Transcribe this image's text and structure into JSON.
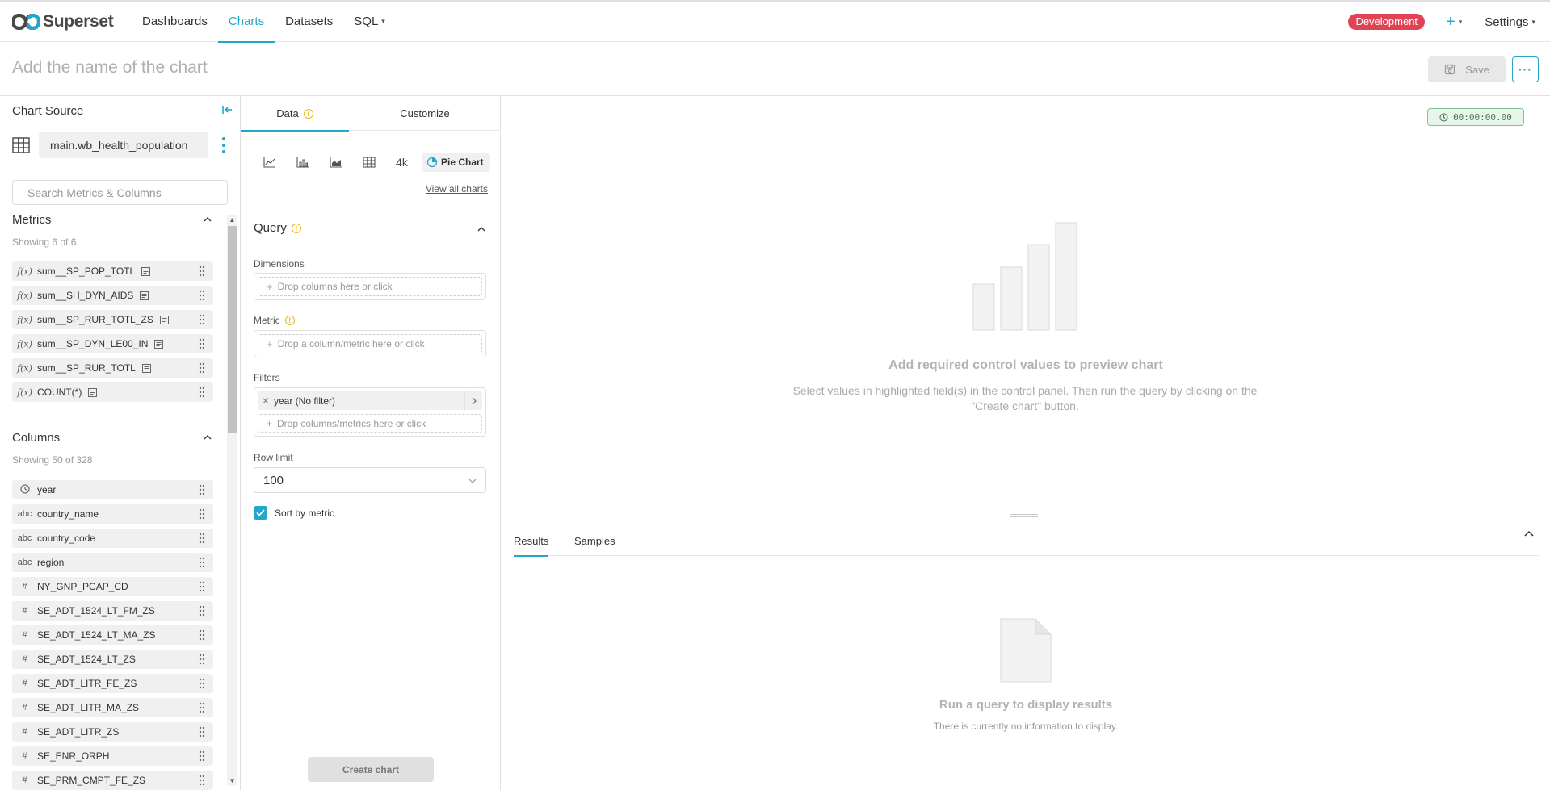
{
  "brand": {
    "name": "Superset"
  },
  "nav": {
    "items": [
      {
        "label": "Dashboards",
        "active": false
      },
      {
        "label": "Charts",
        "active": true
      },
      {
        "label": "Datasets",
        "active": false
      },
      {
        "label": "SQL",
        "active": false
      }
    ],
    "env_badge": "Development",
    "plus_label": "+",
    "settings_label": "Settings"
  },
  "header": {
    "chart_name_placeholder": "Add the name of the chart",
    "save_label": "Save",
    "more_label": "···"
  },
  "datasource": {
    "title": "Chart Source",
    "name": "main.wb_health_population",
    "search_placeholder": "Search Metrics & Columns",
    "metrics_title": "Metrics",
    "metrics_count": "Showing 6 of 6",
    "metrics": [
      {
        "type": "f(x)",
        "label": "sum__SP_POP_TOTL"
      },
      {
        "type": "f(x)",
        "label": "sum__SH_DYN_AIDS"
      },
      {
        "type": "f(x)",
        "label": "sum__SP_RUR_TOTL_ZS"
      },
      {
        "type": "f(x)",
        "label": "sum__SP_DYN_LE00_IN"
      },
      {
        "type": "f(x)",
        "label": "sum__SP_RUR_TOTL"
      },
      {
        "type": "f(x)",
        "label": "COUNT(*)"
      }
    ],
    "columns_title": "Columns",
    "columns_count": "Showing 50 of 328",
    "columns": [
      {
        "type": "clock",
        "label": "year"
      },
      {
        "type": "abc",
        "label": "country_name"
      },
      {
        "type": "abc",
        "label": "country_code"
      },
      {
        "type": "abc",
        "label": "region"
      },
      {
        "type": "#",
        "label": "NY_GNP_PCAP_CD"
      },
      {
        "type": "#",
        "label": "SE_ADT_1524_LT_FM_ZS"
      },
      {
        "type": "#",
        "label": "SE_ADT_1524_LT_MA_ZS"
      },
      {
        "type": "#",
        "label": "SE_ADT_1524_LT_ZS"
      },
      {
        "type": "#",
        "label": "SE_ADT_LITR_FE_ZS"
      },
      {
        "type": "#",
        "label": "SE_ADT_LITR_MA_ZS"
      },
      {
        "type": "#",
        "label": "SE_ADT_LITR_ZS"
      },
      {
        "type": "#",
        "label": "SE_ENR_ORPH"
      },
      {
        "type": "#",
        "label": "SE_PRM_CMPT_FE_ZS"
      }
    ]
  },
  "controls": {
    "tab_data": "Data",
    "tab_customize": "Customize",
    "viz_4k": "4k",
    "viz_selected": "Pie Chart",
    "view_all": "View all charts",
    "query_title": "Query",
    "dimensions_label": "Dimensions",
    "dimensions_placeholder": "Drop columns here or click",
    "metric_label": "Metric",
    "metric_placeholder": "Drop a column/metric here or click",
    "filters_label": "Filters",
    "filter_value": "year (No filter)",
    "filters_placeholder": "Drop columns/metrics here or click",
    "row_limit_label": "Row limit",
    "row_limit_value": "100",
    "sort_by_metric_label": "Sort by metric",
    "sort_by_metric_checked": true,
    "create_chart_label": "Create chart"
  },
  "preview": {
    "timer": "00:00:00.00",
    "empty_title": "Add required control values to preview chart",
    "empty_desc": "Select values in highlighted field(s) in the control panel. Then run the query by clicking on the \"Create chart\" button.",
    "results_tab": "Results",
    "samples_tab": "Samples",
    "results_empty_title": "Run a query to display results",
    "results_empty_desc": "There is currently no information to display."
  },
  "colors": {
    "accent": "#20a7c9",
    "env_badge": "#e04355",
    "warning": "#f0b419",
    "timer_bg": "#e8f5ea"
  }
}
